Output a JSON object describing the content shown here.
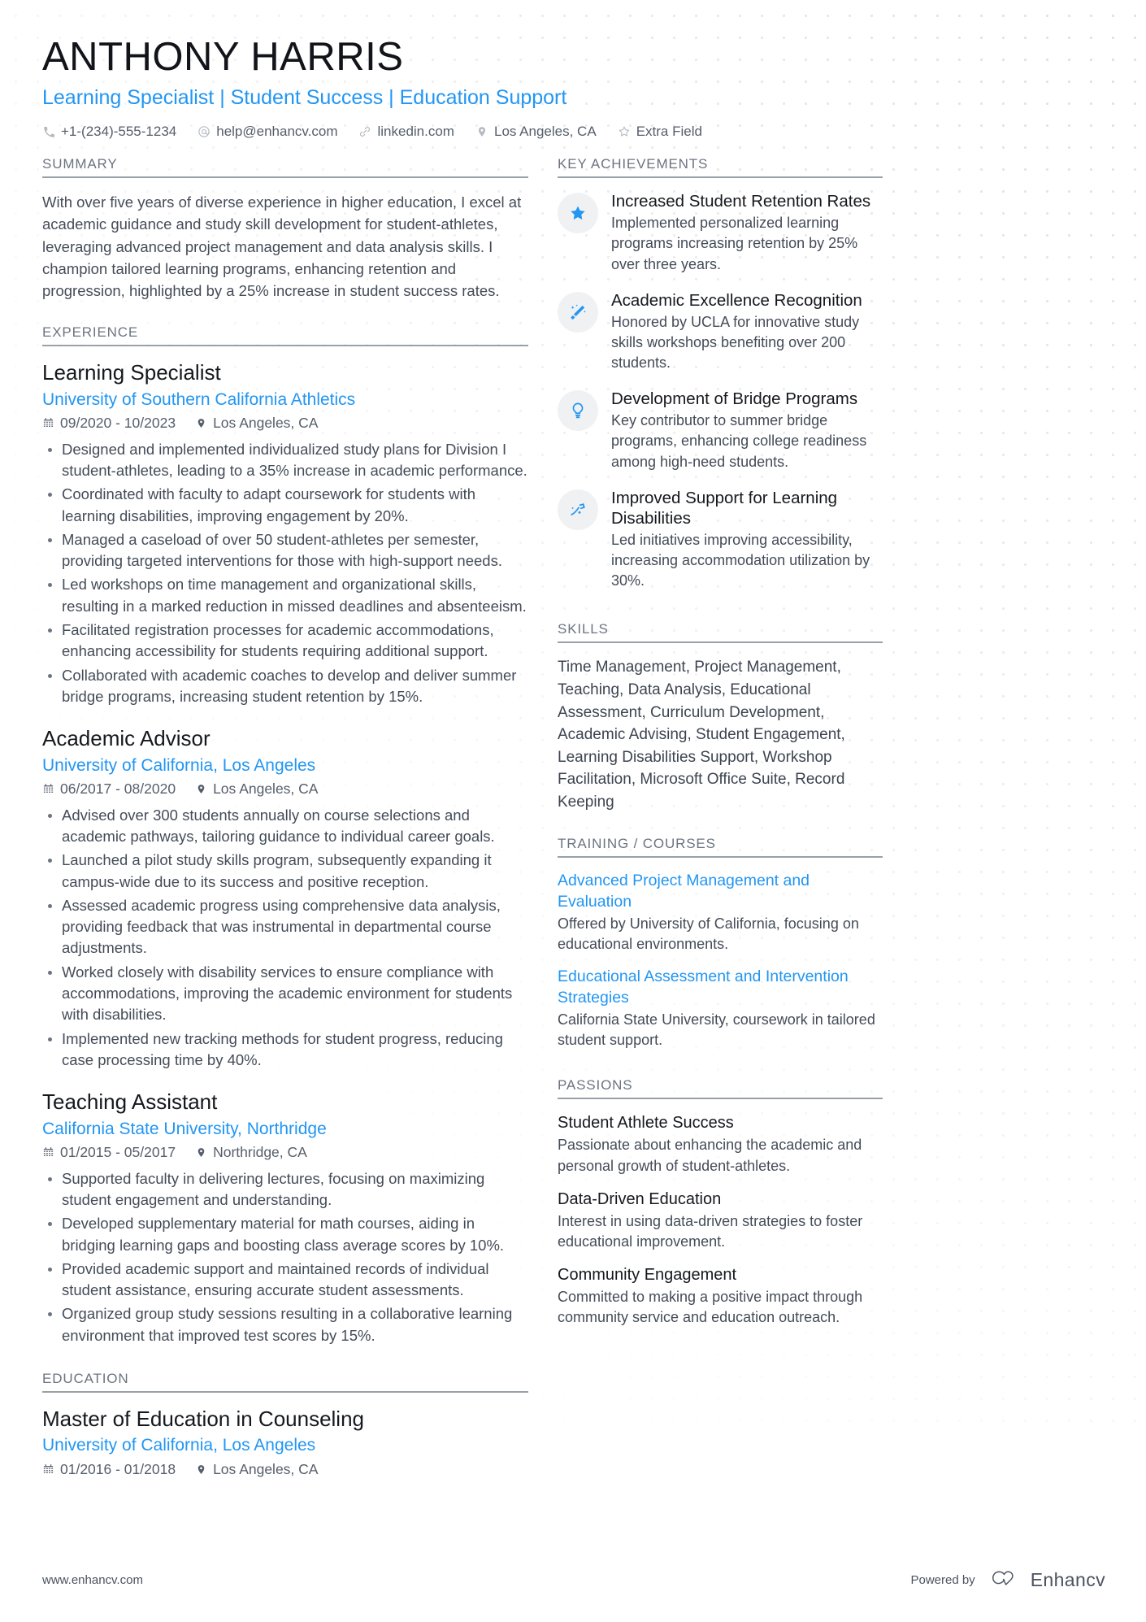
{
  "theme": {
    "accent": "#2196f3",
    "heading_text": "#6b7480",
    "body_text": "#444c58",
    "title_text": "#15181d",
    "badge_bg": "#f0f1f2"
  },
  "header": {
    "name": "ANTHONY HARRIS",
    "headline": "Learning Specialist | Student Success | Education Support",
    "contacts": [
      {
        "icon": "phone-icon",
        "text": "+1-(234)-555-1234"
      },
      {
        "icon": "email-icon",
        "text": "help@enhancv.com"
      },
      {
        "icon": "link-icon",
        "text": "linkedin.com"
      },
      {
        "icon": "location-icon",
        "text": "Los Angeles, CA"
      },
      {
        "icon": "star-outline-icon",
        "text": "Extra Field"
      }
    ]
  },
  "left_column": {
    "summary": {
      "section_title": "SUMMARY",
      "text": "With over five years of diverse experience in higher education, I excel at academic guidance and study skill development for student-athletes, leveraging advanced project management and data analysis skills. I champion tailored learning programs, enhancing retention and progression, highlighted by a 25% increase in student success rates."
    },
    "experience": {
      "section_title": "EXPERIENCE",
      "entries": [
        {
          "title": "Learning Specialist",
          "org": "University of Southern California Athletics",
          "dates": "09/2020 - 10/2023",
          "location": "Los Angeles, CA",
          "bullets": [
            "Designed and implemented individualized study plans for Division I student-athletes, leading to a 35% increase in academic performance.",
            "Coordinated with faculty to adapt coursework for students with learning disabilities, improving engagement by 20%.",
            "Managed a caseload of over 50 student-athletes per semester, providing targeted interventions for those with high-support needs.",
            "Led workshops on time management and organizational skills, resulting in a marked reduction in missed deadlines and absenteeism.",
            "Facilitated registration processes for academic accommodations, enhancing accessibility for students requiring additional support.",
            "Collaborated with academic coaches to develop and deliver summer bridge programs, increasing student retention by 15%."
          ]
        },
        {
          "title": "Academic Advisor",
          "org": "University of California, Los Angeles",
          "dates": "06/2017 - 08/2020",
          "location": "Los Angeles, CA",
          "bullets": [
            "Advised over 300 students annually on course selections and academic pathways, tailoring guidance to individual career goals.",
            "Launched a pilot study skills program, subsequently expanding it campus-wide due to its success and positive reception.",
            "Assessed academic progress using comprehensive data analysis, providing feedback that was instrumental in departmental course adjustments.",
            "Worked closely with disability services to ensure compliance with accommodations, improving the academic environment for students with disabilities.",
            "Implemented new tracking methods for student progress, reducing case processing time by 40%."
          ]
        },
        {
          "title": "Teaching Assistant",
          "org": "California State University, Northridge",
          "dates": "01/2015 - 05/2017",
          "location": "Northridge, CA",
          "bullets": [
            "Supported faculty in delivering lectures, focusing on maximizing student engagement and understanding.",
            "Developed supplementary material for math courses, aiding in bridging learning gaps and boosting class average scores by 10%.",
            "Provided academic support and maintained records of individual student assistance, ensuring accurate student assessments.",
            "Organized group study sessions resulting in a collaborative learning environment that improved test scores by 15%."
          ]
        }
      ]
    },
    "education": {
      "section_title": "EDUCATION",
      "entries": [
        {
          "title": "Master of Education in Counseling",
          "org": "University of California, Los Angeles",
          "dates": "01/2016 - 01/2018",
          "location": "Los Angeles, CA"
        }
      ]
    }
  },
  "right_column": {
    "key_achievements": {
      "section_title": "KEY ACHIEVEMENTS",
      "items": [
        {
          "icon": "star-icon",
          "title": "Increased Student Retention Rates",
          "desc": "Implemented personalized learning programs increasing retention by 25% over three years."
        },
        {
          "icon": "magic-wand-icon",
          "title": "Academic Excellence Recognition",
          "desc": "Honored by UCLA for innovative study skills workshops benefiting over 200 students."
        },
        {
          "icon": "lightbulb-icon",
          "title": "Development of Bridge Programs",
          "desc": "Key contributor to summer bridge programs, enhancing college readiness among high-need students."
        },
        {
          "icon": "trending-up-icon",
          "title": "Improved Support for Learning Disabilities",
          "desc": "Led initiatives improving accessibility, increasing accommodation utilization by 30%."
        }
      ]
    },
    "skills": {
      "section_title": "SKILLS",
      "text": "Time Management, Project Management, Teaching, Data Analysis, Educational Assessment, Curriculum Development, Academic Advising, Student Engagement, Learning Disabilities Support, Workshop Facilitation, Microsoft Office Suite, Record Keeping"
    },
    "training": {
      "section_title": "TRAINING / COURSES",
      "items": [
        {
          "title": "Advanced Project Management and Evaluation",
          "desc": "Offered by University of California, focusing on educational environments."
        },
        {
          "title": "Educational Assessment and Intervention Strategies",
          "desc": "California State University, coursework in tailored student support."
        }
      ]
    },
    "passions": {
      "section_title": "PASSIONS",
      "items": [
        {
          "title": "Student Athlete Success",
          "desc": "Passionate about enhancing the academic and personal growth of student-athletes."
        },
        {
          "title": "Data-Driven Education",
          "desc": "Interest in using data-driven strategies to foster educational improvement."
        },
        {
          "title": "Community Engagement",
          "desc": "Committed to making a positive impact through community service and education outreach."
        }
      ]
    }
  },
  "footer": {
    "url": "www.enhancv.com",
    "powered_by": "Powered by",
    "brand": "Enhancv"
  }
}
